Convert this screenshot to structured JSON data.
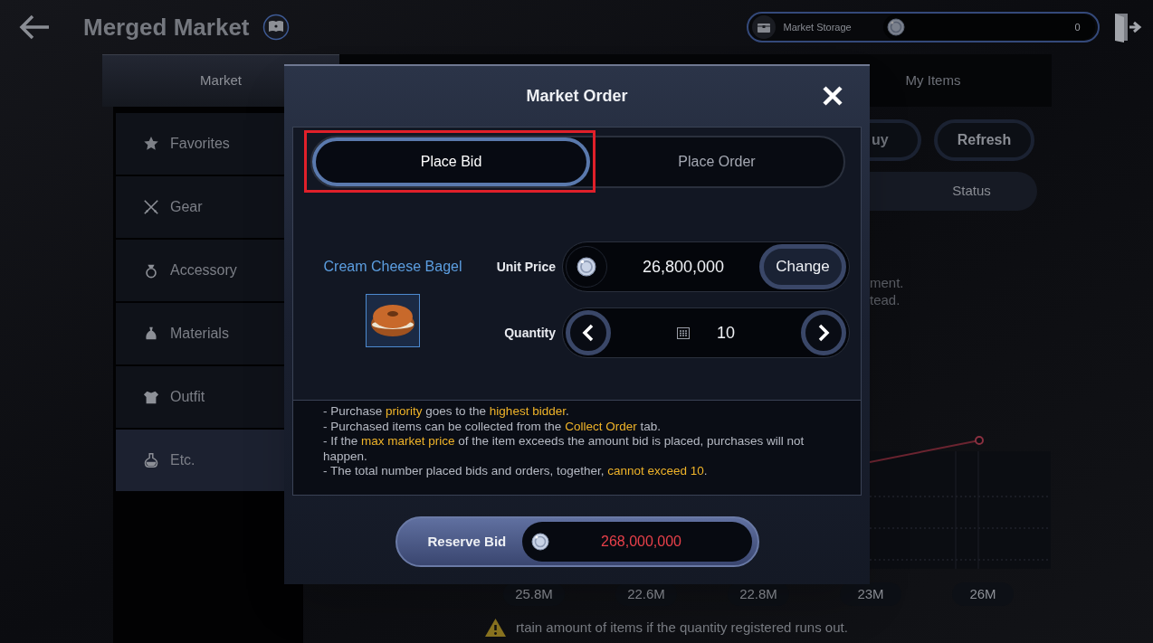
{
  "header": {
    "title": "Merged Market",
    "storage_label": "Market Storage",
    "storage_value": "0"
  },
  "tabs": [
    {
      "label": "Market",
      "selected": true
    },
    {
      "label": "My Items",
      "selected": false
    }
  ],
  "sidebar": {
    "items": [
      {
        "label": "Favorites",
        "kind": "star",
        "selected": false
      },
      {
        "label": "Gear",
        "kind": "swords",
        "selected": false
      },
      {
        "label": "Accessory",
        "kind": "ring",
        "selected": false
      },
      {
        "label": "Materials",
        "kind": "pouch",
        "selected": false
      },
      {
        "label": "Outfit",
        "kind": "armor",
        "selected": false
      },
      {
        "label": "Etc.",
        "kind": "flask",
        "selected": true
      }
    ]
  },
  "toolbar": {
    "buttons": [
      "uy",
      "Refresh"
    ]
  },
  "status_tab": "Status",
  "notice_fragments": [
    "ment.",
    "tead."
  ],
  "price_labels": [
    "25.8M",
    "22.6M",
    "22.8M",
    "23M",
    "26M"
  ],
  "warning": "rtain amount of items if the quantity registered runs out.",
  "dialog": {
    "title": "Market Order",
    "tabs": [
      {
        "label": "Place Bid",
        "selected": true,
        "highlighted": true
      },
      {
        "label": "Place Order",
        "selected": false,
        "highlighted": false
      }
    ],
    "item_name": "Cream Cheese Bagel",
    "unit_price": {
      "label": "Unit Price",
      "value": "26,800,000",
      "button": "Change"
    },
    "quantity": {
      "label": "Quantity",
      "value": "10"
    },
    "notes": [
      "- Purchase **priority** goes to the **highest bidder**.",
      "- Purchased items can be collected from the **Collect Order** tab.",
      "- If the **max market price** of the item exceeds the amount bid is placed, purchases will not happen.",
      "- The total number placed bids and orders, together, **cannot exceed 10**."
    ],
    "reserve": {
      "label": "Reserve Bid",
      "value": "268,000,000"
    }
  }
}
